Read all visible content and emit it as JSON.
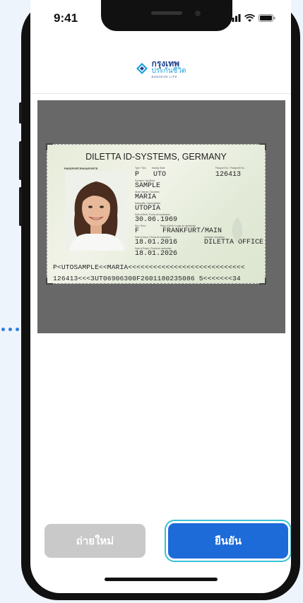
{
  "status_bar": {
    "time": "9:41"
  },
  "header": {
    "logo_line1": "กรุงเทพ",
    "logo_line2": "ประกันชีวิต",
    "logo_line3": "BANGKOK LIFE"
  },
  "passport": {
    "title": "DILETTA ID-SYSTEMS, GERMANY",
    "doc_label": "PASSPORT/PASAPORTE",
    "type_label": "Type / Tipo",
    "issuing_label": "Issuing State",
    "passport_no_label": "Passport No. / Pasaporte No.",
    "type": "P",
    "issuing_state": "UTO",
    "passport_no": "126413",
    "surname_label": "Surname / Apellidos",
    "surname": "SAMPLE",
    "given_label": "Given Names / Nombres",
    "given": "MARIA",
    "nationality_label": "Nationality / Nacionalidad",
    "nationality": "UTOPIA",
    "dob_label": "Date of Birth / Fecha de nacimiento",
    "dob": "30.06.1969",
    "sex_label": "Sex / Sexo",
    "pob_label": "Place of birth / Lugar de nacimiento",
    "sex": "F",
    "place_of_birth": "FRANKFURT/MAIN",
    "issue_label": "Date of Issue / Fecha de expedicion",
    "authority_label": "Authority / Autoridad",
    "issue_date": "18.01.2016",
    "authority": "DILETTA OFFICE",
    "expiry_label": "Date of Expiry / Fecha de caducidad",
    "expiry_date": "18.01.2026",
    "mrz1": "P<UTOSAMPLE<<MARIA<<<<<<<<<<<<<<<<<<<<<<<<<<<<",
    "mrz2": "126413<<<3UT06906300F2601180235086 5<<<<<<<34"
  },
  "actions": {
    "retake_label": "ถ่ายใหม่",
    "confirm_label": "ยืนยัน"
  },
  "colors": {
    "primary": "#1d6bd9",
    "disabled": "#c9c9c9",
    "focus_ring": "#38c1d6"
  }
}
